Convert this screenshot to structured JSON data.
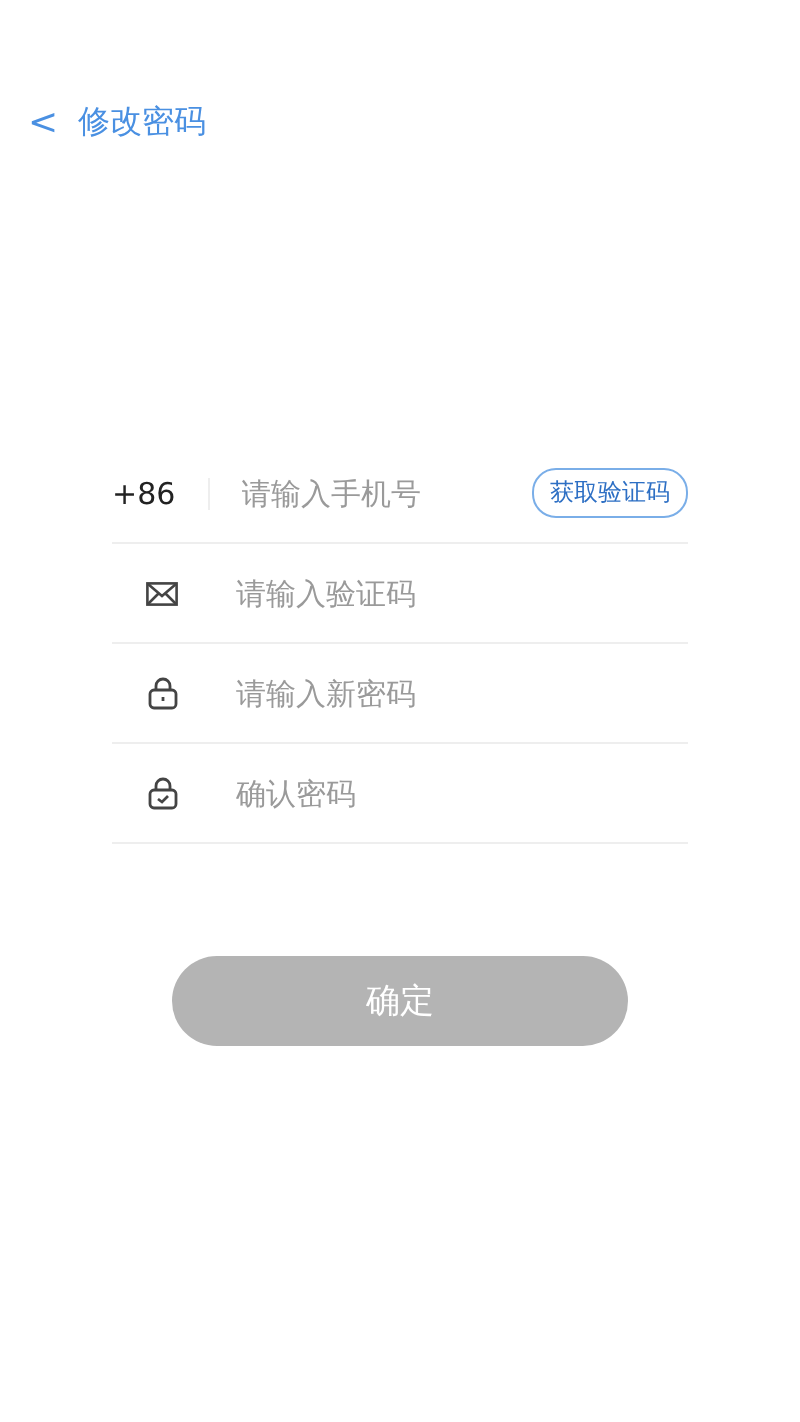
{
  "header": {
    "back": "<",
    "title": "修改密码"
  },
  "fields": [
    {
      "kind": "phone",
      "prefix": "+86",
      "placeholder": "请输入手机号",
      "action": "获取验证码"
    },
    {
      "kind": "code",
      "placeholder": "请输入验证码"
    },
    {
      "kind": "password",
      "placeholder": "请输入新密码"
    },
    {
      "kind": "confirm",
      "placeholder": "确认密码"
    }
  ],
  "submit": {
    "label": "确定",
    "disabled": true
  }
}
